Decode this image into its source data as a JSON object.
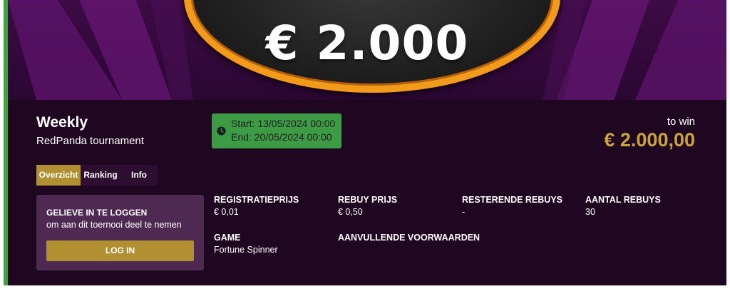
{
  "banner": {
    "prize_text": "€ 2.000"
  },
  "tournament": {
    "title": "Weekly",
    "subtitle": "RedPanda tournament",
    "start": "Start: 13/05/2024 00:00",
    "end": "End: 20/05/2024 00:00",
    "towin_label": "to win",
    "towin_value": "€ 2.000,00"
  },
  "tabs": [
    {
      "label": "Overzicht",
      "active": true
    },
    {
      "label": "Ranking",
      "active": false
    },
    {
      "label": "Info",
      "active": false
    }
  ],
  "login": {
    "title": "GELIEVE IN TE LOGGEN",
    "message": "om aan dit toernooi deel te nemen",
    "button": "LOG IN"
  },
  "details": {
    "registration_label": "REGISTRATIEPRIJS",
    "registration_value": "€ 0,01",
    "rebuy_label": "REBUY PRIJS",
    "rebuy_value": "€ 0,50",
    "remaining_label": "RESTERENDE REBUYS",
    "remaining_value": "-",
    "count_label": "AANTAL REBUYS",
    "count_value": "30",
    "game_label": "GAME",
    "game_value": "Fortune Spinner",
    "conditions_label": "AANVULLENDE VOORWAARDEN"
  },
  "colors": {
    "accent_gold": "#b09030",
    "prize_gold": "#c9a43c",
    "date_green": "#3d9a45",
    "card_bg": "#200721",
    "oval_orange": "#f29a1a"
  },
  "icons": {
    "clock": "clock-icon"
  }
}
